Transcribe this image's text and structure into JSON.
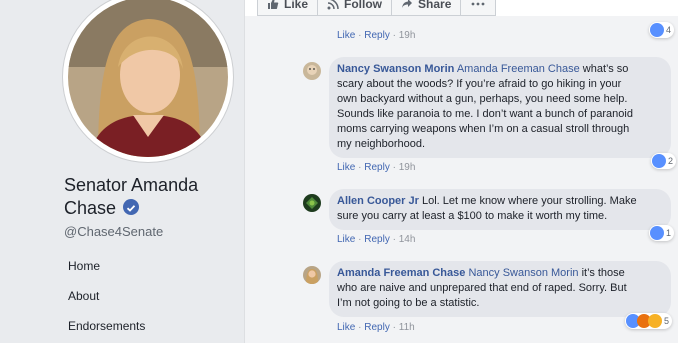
{
  "page": {
    "name_line1": "Senator Amanda",
    "name_line2": "Chase",
    "handle": "@Chase4Senate",
    "nav": [
      "Home",
      "About",
      "Endorsements"
    ]
  },
  "post_actions": {
    "like": "Like",
    "follow": "Follow",
    "share": "Share"
  },
  "comment_action": {
    "like": "Like",
    "reply": "Reply",
    "sep": "·"
  },
  "top_meta_time": "19h",
  "top_reaction_count": "4",
  "comments": [
    {
      "author": "Nancy Swanson Morin",
      "mention": "Amanda Freeman Chase",
      "text_first": " what’s so",
      "text_lines": [
        "scary about the woods? If you’re afraid to go hiking in your",
        "own backyard without a gun, perhaps, you need some help.",
        "Sounds like paranoia to me. I don’t want a bunch of paranoid",
        "moms carrying weapons when I’m on a casual stroll through",
        "my neighborhood."
      ],
      "time": "19h",
      "reaction_count": "2"
    },
    {
      "author": "Allen Cooper Jr",
      "mention": "",
      "text_first": " Lol. Let me know where your strolling. Make",
      "text_lines": [
        "sure you carry at least a $100 to make it worth my time."
      ],
      "time": "14h",
      "reaction_count": "1"
    },
    {
      "author": "Amanda Freeman Chase",
      "mention": "Nancy Swanson Morin",
      "text_first": " it’s those",
      "text_lines": [
        "who are naive and unprepared that end of raped. Sorry. But",
        "I’m not going to be a statistic."
      ],
      "time": "11h",
      "reaction_count": "5"
    }
  ],
  "colors": {
    "link": "#385898",
    "bubble": "#e4e6eb",
    "accent": "#4267b2"
  }
}
